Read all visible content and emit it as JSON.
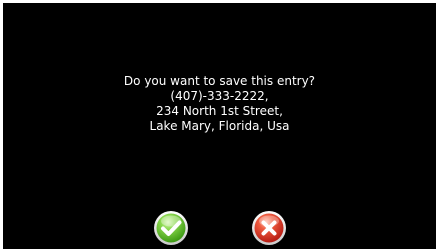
{
  "dialog": {
    "question": "Do you want to save this entry?",
    "lines": [
      "(407)-333-2222,",
      "234 North 1st Street,",
      "Lake Mary, Florida, Usa"
    ]
  },
  "buttons": {
    "confirm_icon": "checkmark-icon",
    "cancel_icon": "x-icon"
  },
  "colors": {
    "background": "#000000",
    "text": "#ffffff",
    "confirm": "#5cc12a",
    "cancel": "#d8312a"
  }
}
